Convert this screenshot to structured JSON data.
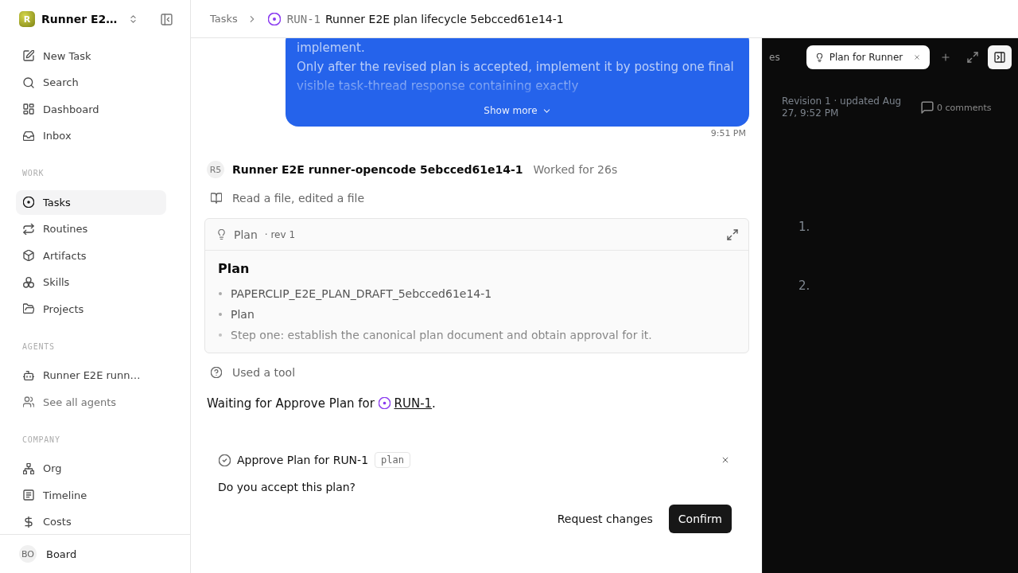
{
  "sidebar": {
    "workspace": {
      "initial": "R",
      "name": "Runner E2…"
    },
    "items": [
      {
        "label": "New Task",
        "selected": false
      },
      {
        "label": "Search",
        "selected": false
      },
      {
        "label": "Dashboard",
        "selected": false
      },
      {
        "label": "Inbox",
        "selected": false
      }
    ],
    "sections": [
      {
        "title": "WORK",
        "items": [
          {
            "label": "Tasks",
            "selected": true
          },
          {
            "label": "Routines",
            "selected": false
          },
          {
            "label": "Artifacts",
            "selected": false
          },
          {
            "label": "Skills",
            "selected": false
          },
          {
            "label": "Projects",
            "selected": false
          }
        ]
      },
      {
        "title": "AGENTS",
        "items": [
          {
            "label": "Runner E2E runn…",
            "selected": false,
            "kind": "agent"
          },
          {
            "label": "See all agents",
            "selected": false,
            "kind": "link"
          }
        ]
      },
      {
        "title": "COMPANY",
        "items": [
          {
            "label": "Org",
            "selected": false
          },
          {
            "label": "Timeline",
            "selected": false
          },
          {
            "label": "Costs",
            "selected": false
          }
        ]
      }
    ],
    "user": {
      "initials": "BO",
      "name": "Board"
    }
  },
  "breadcrumb": {
    "parent": "Tasks",
    "task_id": "RUN-1",
    "title": "Runner E2E plan lifecycle 5ebcced61e14-1"
  },
  "message": {
    "lines": [
      "implement.",
      "Only after the revised plan is accepted, implement it by posting one final",
      "visible task-thread response containing exactly"
    ],
    "toggle": "Show more",
    "time": "9:51 PM"
  },
  "run": {
    "avatar": "R5",
    "agent": "Runner E2E runner-opencode 5ebcced61e14-1",
    "duration": "Worked for 26s",
    "steps": [
      {
        "kind": "files",
        "text": "Read a file, edited a file"
      },
      {
        "kind": "plan",
        "label": "Plan",
        "revision": "· rev 1",
        "heading": "Plan",
        "bullets": [
          "PAPERCLIP_E2E_PLAN_DRAFT_5ebcced61e14-1",
          "Plan",
          "Step one: establish the canonical plan document and obtain approval for it."
        ]
      },
      {
        "kind": "tool",
        "text": "Used a tool"
      }
    ]
  },
  "waiting": {
    "text": "Waiting for Approve Plan for",
    "task_id": "RUN-1",
    "end": "."
  },
  "approval": {
    "title": "Approve Plan for RUN-1",
    "tag": "plan",
    "question": "Do you accept this plan?",
    "actions": [
      {
        "label": "Request changes",
        "kind": "secondary"
      },
      {
        "label": "Confirm",
        "kind": "primary"
      }
    ]
  },
  "panel": {
    "tabs": [
      {
        "label": "es",
        "selected": false
      },
      {
        "label": "Plan for Runner",
        "selected": true
      }
    ],
    "meta": "Revision 1 · updated Aug 27, 9:52 PM",
    "comments": "0 comments",
    "markers": [
      "1.",
      "2."
    ]
  }
}
